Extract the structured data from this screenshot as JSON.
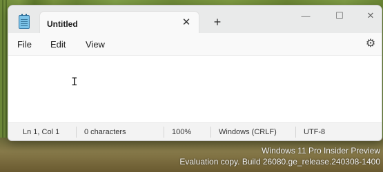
{
  "window": {
    "tab_title": "Untitled",
    "tab_close_glyph": "✕",
    "new_tab_glyph": "+",
    "controls": {
      "minimize": "—",
      "maximize": "☐",
      "close": "✕"
    }
  },
  "menubar": {
    "items": [
      "File",
      "Edit",
      "View"
    ],
    "settings_glyph": "⚙"
  },
  "editor": {
    "content": "",
    "cursor_glyph": "I"
  },
  "statusbar": {
    "position": "Ln 1, Col 1",
    "characters": "0 characters",
    "zoom": "100%",
    "line_ending": "Windows (CRLF)",
    "encoding": "UTF-8"
  },
  "desktop": {
    "watermark_line1": "Windows 11 Pro Insider Preview",
    "watermark_line2": "Evaluation copy. Build 26080.ge_release.240308-1400"
  },
  "colors": {
    "window_bg": "#f3f3f3",
    "editor_bg": "#ffffff",
    "titlebar_bg": "#e9eaea"
  }
}
